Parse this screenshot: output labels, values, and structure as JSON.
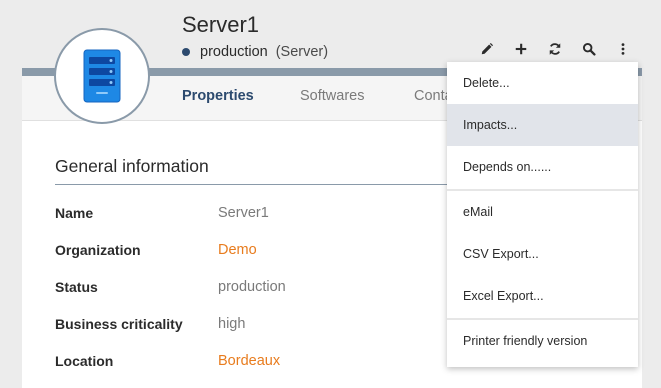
{
  "header": {
    "title": "Server1",
    "status": "production",
    "type": "(Server)"
  },
  "toolbar": {
    "icons": [
      "pencil-icon",
      "plus-icon",
      "refresh-icon",
      "search-icon",
      "more-icon"
    ]
  },
  "tabs": [
    {
      "label": "Properties",
      "active": true
    },
    {
      "label": "Softwares",
      "active": false
    },
    {
      "label": "Conta",
      "active": false
    }
  ],
  "section": {
    "title": "General information",
    "fields": [
      {
        "label": "Name",
        "value": "Server1",
        "link": false
      },
      {
        "label": "Organization",
        "value": "Demo",
        "link": true
      },
      {
        "label": "Status",
        "value": "production",
        "link": false
      },
      {
        "label": "Business criticality",
        "value": "high",
        "link": false
      },
      {
        "label": "Location",
        "value": "Bordeaux",
        "link": true
      }
    ]
  },
  "menu": {
    "items": [
      {
        "label": "Delete..."
      },
      {
        "label": "Impacts..."
      },
      {
        "label": "Depends on......"
      },
      {
        "label": "eMail"
      },
      {
        "label": "CSV Export..."
      },
      {
        "label": "Excel Export..."
      },
      {
        "label": "Printer friendly version"
      }
    ]
  },
  "colors": {
    "accent": "#2c4a6e",
    "link": "#e87c1e",
    "border": "#8a9aa9",
    "highlight": "#e1e4ea"
  }
}
